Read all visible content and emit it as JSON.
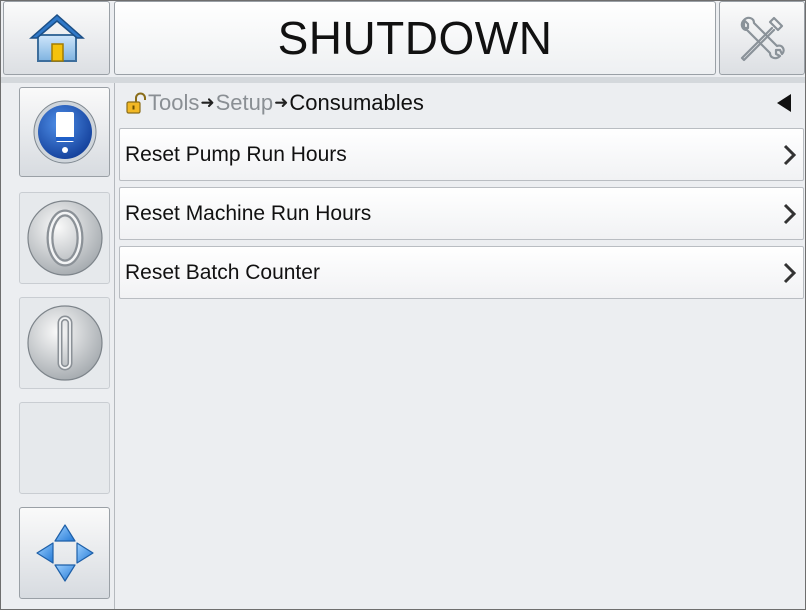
{
  "header": {
    "title": "SHUTDOWN",
    "home_icon": "home-icon",
    "tools_icon": "tools-icon"
  },
  "sidebar": {
    "items": [
      {
        "icon": "ink-cartridge-icon",
        "state": "active"
      },
      {
        "icon": "start-jet-icon",
        "state": "inactive"
      },
      {
        "icon": "stop-jet-icon",
        "state": "inactive"
      },
      {
        "icon": "empty",
        "state": "inactive"
      },
      {
        "icon": "navigation-arrows-icon",
        "state": "active"
      }
    ]
  },
  "breadcrumb": {
    "lock_icon": "unlocked-padlock-icon",
    "parts": [
      "Tools",
      "Setup",
      "Consumables"
    ],
    "back_icon": "back-arrow-icon"
  },
  "menu": {
    "items": [
      {
        "label": "Reset Pump Run Hours"
      },
      {
        "label": "Reset Machine Run Hours"
      },
      {
        "label": "Reset Batch Counter"
      }
    ]
  },
  "colors": {
    "accent_blue": "#1f5fc8",
    "house_red": "#c62828",
    "house_door": "#f4c20d",
    "background": "#eceef1"
  }
}
